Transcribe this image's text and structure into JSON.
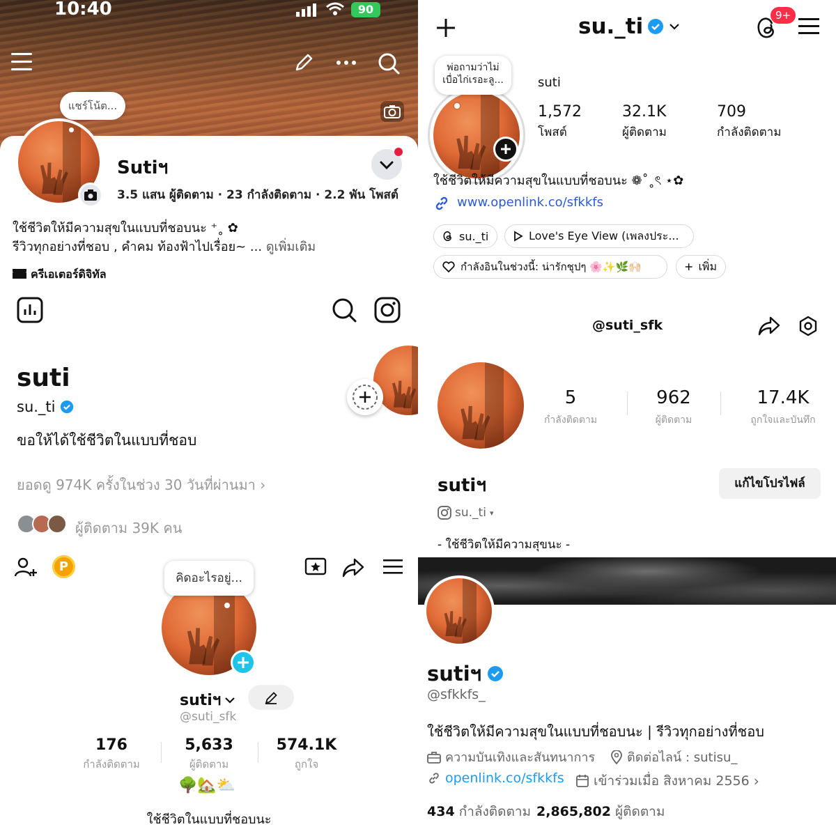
{
  "facebook": {
    "status_time": "10:40",
    "battery": "90",
    "note_bubble": "แชร์โน้ต...",
    "name": "Sutiฯ",
    "stats": "3.5 แสน ผู้ติดตาม · 23 กำลังติดตาม · 2.2 พัน โพสต์",
    "bio_line1": "ใช้ชีวิตให้มีความสุขในแบบที่ชอบนะ ⁺˳ ✿",
    "bio_line2": "รีวิวทุกอย่างที่ชอบ , คำคม ท้องฟ้าไปเรื่อย~ ...",
    "see_more": "ดูเพิ่มเติม",
    "category": "ครีเอเตอร์ดิจิทัล"
  },
  "instagram": {
    "username": "su._ti",
    "notif_badge": "9+",
    "note_bubble": "พ่อถามว่าไม่เบื่อไก่เรอะลู...",
    "display_name": "suti",
    "stats": [
      {
        "value": "1,572",
        "label": "โพสต์"
      },
      {
        "value": "32.1K",
        "label": "ผู้ติดตาม"
      },
      {
        "value": "709",
        "label": "กำลังติดตาม"
      }
    ],
    "bio": "ใช้ชีวิตให้มีความสุขในแบบที่ชอบนะ ❁˚˳ৎ ⋆✿",
    "link": "www.openlink.co/sfkkfs",
    "threads_chip": "su._ti",
    "music_chip": "Love's Eye View (เพลงประ...",
    "mood_chip": "กำลังอินในช่วงนี้: น่ารักชุปๆ 🌸✨🌿🙌🏻",
    "more_chip": "เพิ่ม"
  },
  "threads": {
    "name": "suti",
    "handle": "su._ti",
    "bio": "ขอให้ได้ใช้ชีวิตในแบบที่ชอบ",
    "views": "ยอดดู 974K ครั้งในช่วง 30 วันที่ผ่านมา",
    "followers": "ผู้ติดตาม 39K คน"
  },
  "tiktok_right": {
    "handle": "@suti_sfk",
    "stats": [
      {
        "value": "5",
        "label": "กำลังติดตาม"
      },
      {
        "value": "962",
        "label": "ผู้ติดตาม"
      },
      {
        "value": "17.4K",
        "label": "ถูกใจและบันทึก"
      }
    ],
    "name": "sutiฯ",
    "edit_button": "แก้ไขโปรไฟล์",
    "ig_link": "su._ti",
    "bio": "- ใช้ชีวิตให้มีความสุขนะ -"
  },
  "tiktok_left": {
    "coin": "P",
    "note_bubble": "คิดอะไรอยู่...",
    "name": "sutiฯ",
    "handle": "@suti_sfk",
    "stats": [
      {
        "value": "176",
        "label": "กำลังติดตาม"
      },
      {
        "value": "5,633",
        "label": "ผู้ติดตาม"
      },
      {
        "value": "574.1K",
        "label": "ถูกใจ"
      }
    ],
    "emoji": "🌳🏡⛅",
    "bio": "ใช้ชีวิตในแบบที่ชอบนะ"
  },
  "x": {
    "name": "sutiฯ",
    "handle": "@sfkkfs_",
    "bio": "ใช้ชีวิตให้มีความสุขในแบบที่ชอบนะ | รีวิวทุกอย่างที่ชอบ",
    "category": "ความบันเทิงและสันทนาการ",
    "contact": "ติดต่อไลน์ : sutisu_",
    "link": "openlink.co/sfkkfs",
    "joined": "เข้าร่วมเมื่อ สิงหาคม 2556",
    "following_count": "434",
    "following_label": "กำลังติดตาม",
    "followers_count": "2,865,802",
    "followers_label": "ผู้ติดตาม"
  },
  "colors": {
    "verified_blue": "#1d9bf0",
    "link_blue": "#2b5bd7",
    "tiktok_cyan": "#20c4e8",
    "coin_orange": "#f5a100",
    "badge_red": "#ff2d48"
  }
}
